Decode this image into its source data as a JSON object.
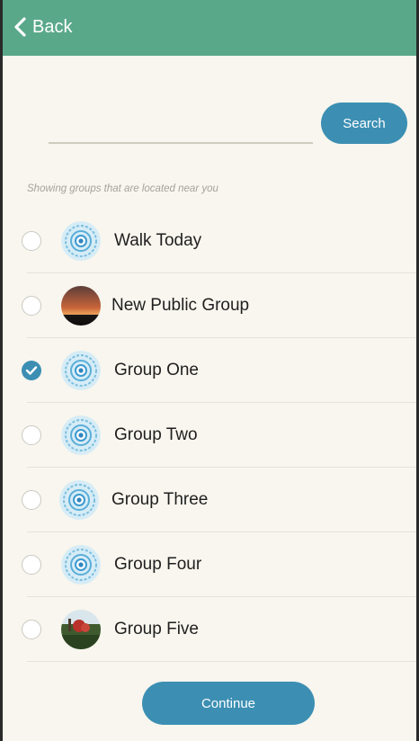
{
  "header": {
    "back_label": "Back",
    "color": "#5aa88a"
  },
  "search": {
    "value": "",
    "placeholder": "",
    "button_label": "Search"
  },
  "hint_text": "Showing groups that are located near you",
  "groups": [
    {
      "name": "Walk Today",
      "selected": false,
      "avatar": "mandala-icon"
    },
    {
      "name": "New Public Group",
      "selected": false,
      "avatar": "sunset-photo"
    },
    {
      "name": "Group One",
      "selected": true,
      "avatar": "mandala-icon"
    },
    {
      "name": "Group Two",
      "selected": false,
      "avatar": "mandala-icon"
    },
    {
      "name": "Group Three",
      "selected": false,
      "avatar": "mandala-icon"
    },
    {
      "name": "Group Four",
      "selected": false,
      "avatar": "mandala-icon"
    },
    {
      "name": "Group Five",
      "selected": false,
      "avatar": "field-photo"
    }
  ],
  "continue_label": "Continue",
  "colors": {
    "accent": "#3c8fb3",
    "background": "#f8f6ee"
  }
}
